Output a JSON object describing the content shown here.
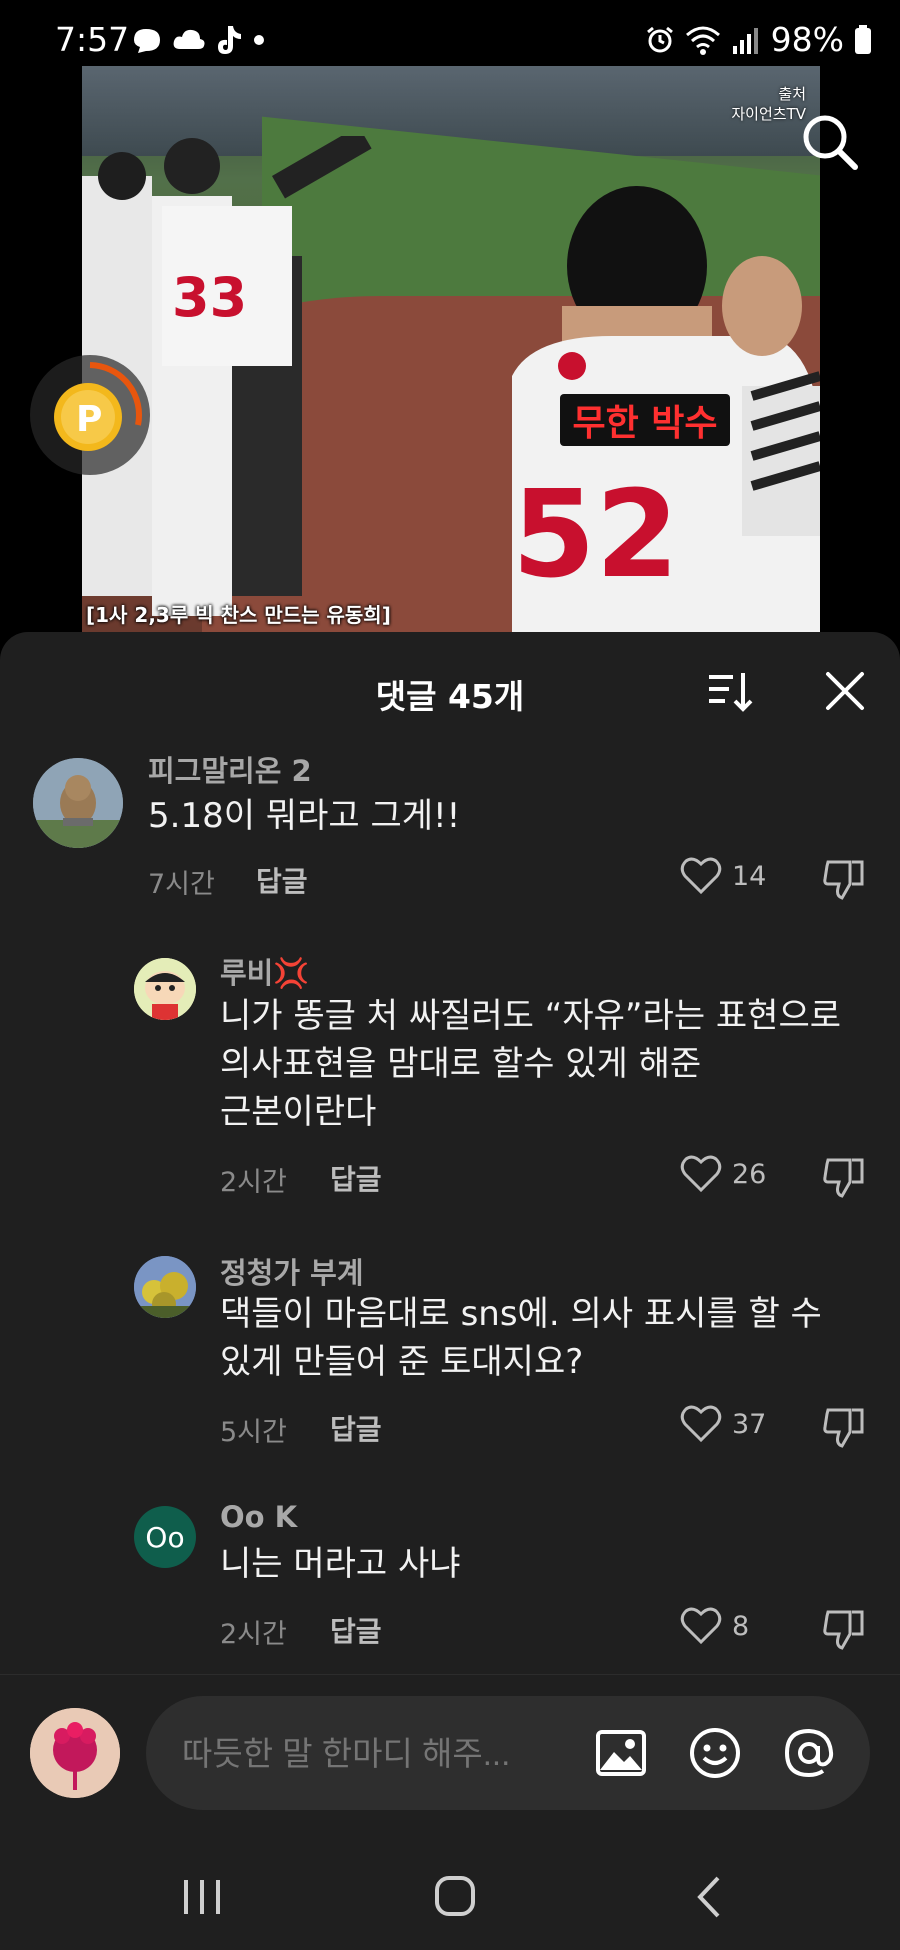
{
  "status": {
    "time": "7:57",
    "battery": "98%"
  },
  "video": {
    "source_label": "출처",
    "source_channel": "자이언츠TV",
    "caption": "무한 박수",
    "subtitle": "[1사 2,3루 빅 찬스 만드는 유동희]"
  },
  "comments_sheet": {
    "title": "댓글 45개",
    "comments": [
      {
        "user": "피그말리온 2",
        "text_lines": [
          "5.18이 뭐라고 그게!!"
        ],
        "time": "7시간",
        "reply": "답글",
        "likes": "14"
      },
      {
        "user": "루비💢",
        "text_lines": [
          "니가 똥글 처 싸질러도 “자유”라는 표현으로",
          "의사표현을 맘대로 할수 있게 해준",
          "근본이란다"
        ],
        "time": "2시간",
        "reply": "답글",
        "likes": "26"
      },
      {
        "user": "정청가 부계",
        "text_lines": [
          "댁들이 마음대로 sns에. 의사 표시를 할 수",
          "있게 만들어 준 토대지요?"
        ],
        "time": "5시간",
        "reply": "답글",
        "likes": "37"
      },
      {
        "user": "Oo K",
        "avatar_text": "Oo",
        "text_lines": [
          "니는 머라고 사냐"
        ],
        "time": "2시간",
        "reply": "답글",
        "likes": "8"
      }
    ]
  },
  "composer": {
    "placeholder": "따듯한 말 한마디 해주..."
  },
  "colors": {
    "sheet_bg": "#1f1f1f",
    "composer_bg": "#2e2e2e",
    "caption_red": "#ff3030",
    "ook_avatar": "#0f5e4c"
  }
}
